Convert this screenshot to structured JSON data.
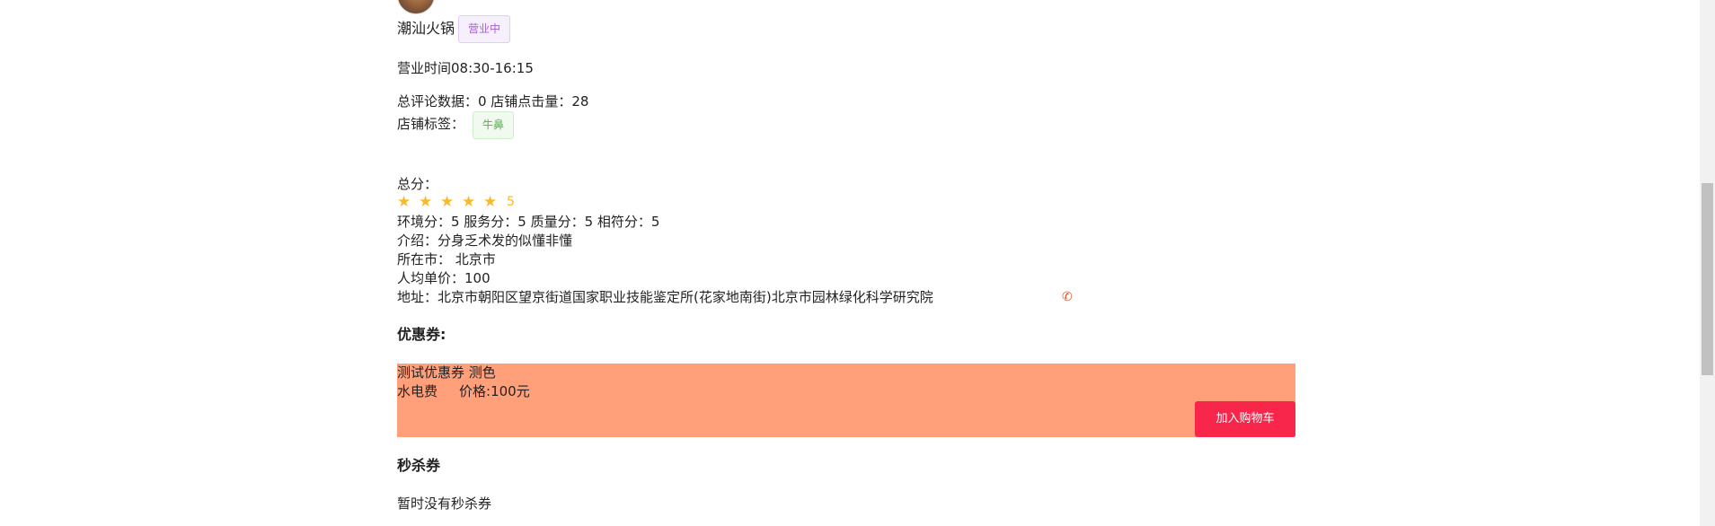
{
  "shop": {
    "name": "潮汕火锅",
    "status": "营业中",
    "hours": "营业时间08:30-16:15",
    "stats": "总评论数据：0 店铺点击量：28",
    "tags_label": "店铺标签：",
    "tags": [
      "牛鼻"
    ],
    "score_label": "总分：",
    "rating": 5,
    "rating_text": "5",
    "scores": "环境分：5 服务分：5 质量分：5 相符分：5",
    "intro": "介绍：分身乏术发的似懂非懂",
    "city": "所在市： 北京市",
    "price": "人均单价：100",
    "address": "地址：北京市朝阳区望京街道国家职业技能鉴定所(花家地南街)北京市园林绿化科学研究院",
    "phone_icon": "phone-icon"
  },
  "coupons": {
    "title": "优惠券:",
    "items": [
      {
        "name": "测试优惠券 测色",
        "desc": "水电费",
        "price": "价格:100元",
        "button": "加入购物车",
        "color": "#ffa07a"
      }
    ]
  },
  "seckill": {
    "title": "秒杀券",
    "empty": "暂时没有秒杀券"
  },
  "colors": {
    "star": "#f7ba2a",
    "cart_button": "#f7264a",
    "status_badge": "#a45fd1",
    "tag_badge": "#52b04a"
  }
}
